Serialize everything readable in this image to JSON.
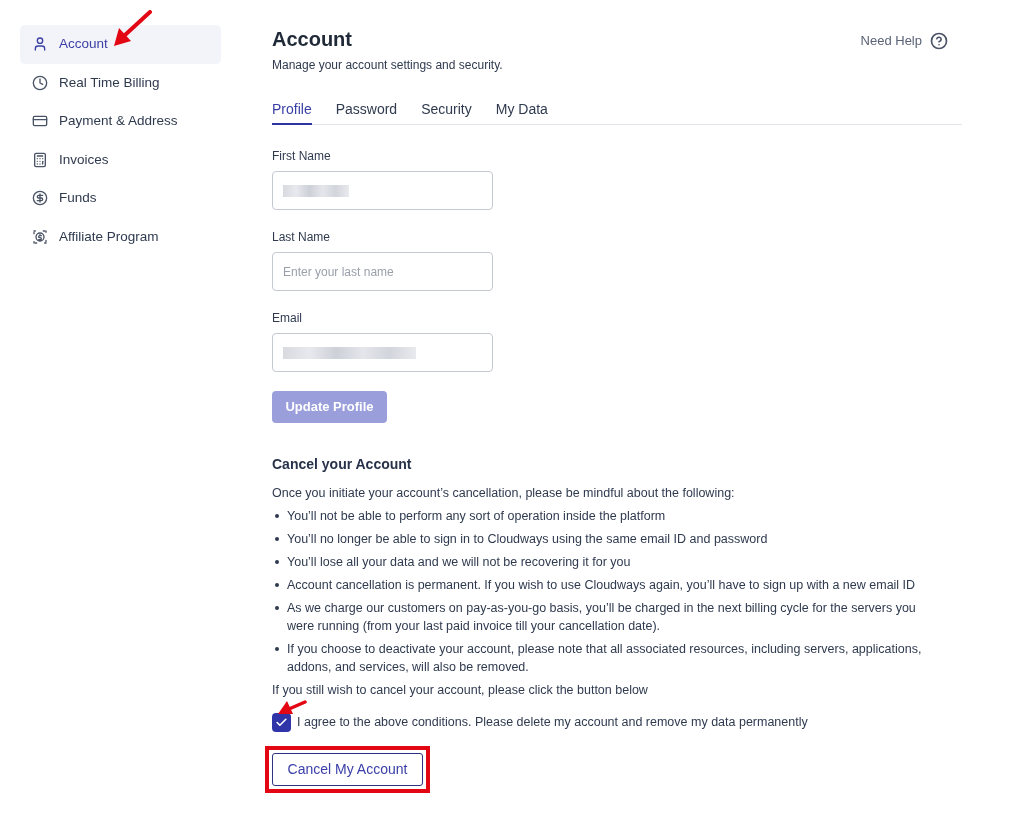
{
  "sidebar": {
    "items": [
      {
        "label": "Account",
        "selected": true
      },
      {
        "label": "Real Time Billing",
        "selected": false
      },
      {
        "label": "Payment & Address",
        "selected": false
      },
      {
        "label": "Invoices",
        "selected": false
      },
      {
        "label": "Funds",
        "selected": false
      },
      {
        "label": "Affiliate Program",
        "selected": false
      }
    ]
  },
  "header": {
    "title": "Account",
    "subtitle": "Manage your account settings and security.",
    "help_link": "Need Help"
  },
  "tabs": [
    {
      "label": "Profile",
      "selected": true
    },
    {
      "label": "Password",
      "selected": false
    },
    {
      "label": "Security",
      "selected": false
    },
    {
      "label": "My Data",
      "selected": false
    }
  ],
  "profile_form": {
    "fields": [
      {
        "label": "First Name",
        "redacted": true
      },
      {
        "label": "Last Name",
        "placeholder": "Enter your last name",
        "redacted": false
      },
      {
        "label": "Email",
        "redacted": true
      }
    ],
    "submit": {
      "label": "Update Profile",
      "disabled": true
    }
  },
  "cancel_section": {
    "heading": "Cancel your Account",
    "intro": "Once you initiate your account’s cancellation, please be mindful about the following:",
    "bullets": [
      "You’ll not be able to perform any sort of operation inside the platform",
      "You’ll no longer be able to sign in to Cloudways using the same email ID and password",
      "You’ll lose all your data and we will not be recovering it for you",
      "Account cancellation is permanent. If you wish to use Cloudways again, you’ll have to sign up with a new email ID",
      "As we charge our customers on pay-as-you-go basis, you’ll be charged in the next billing cycle for the servers you were running (from your last paid invoice till your cancellation date).",
      "If you choose to deactivate your account, please note that all associated resources, including servers, applications, addons, and services, will also be removed."
    ],
    "prompt": "If you still wish to cancel your account, please click the button below",
    "agreement": {
      "label": "I agree to the above conditions. Please delete my account and remove my data permanently",
      "checked": true
    },
    "button": {
      "label": "Cancel My Account"
    }
  }
}
